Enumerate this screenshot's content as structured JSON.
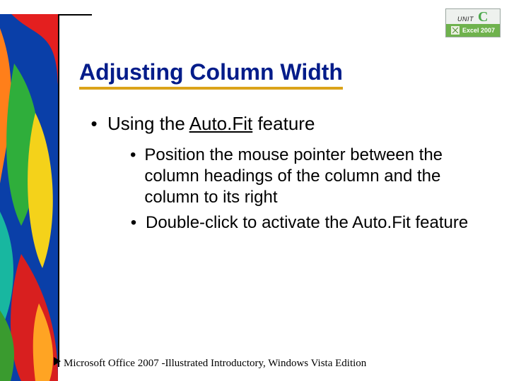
{
  "badge": {
    "unit_label": "UNIT",
    "unit_letter": "C",
    "product": "Excel 2007"
  },
  "title": "Adjusting Column Width",
  "bullets": {
    "lvl1_prefix": "Using the ",
    "lvl1_emph": "Auto.Fit",
    "lvl1_suffix": " feature",
    "lvl2": [
      "Position the mouse pointer between the column headings of the column and the column to its right",
      "Double-click to activate the Auto.Fit feature"
    ]
  },
  "footer": "Microsoft Office 2007 -Illustrated Introductory, Windows Vista Edition"
}
